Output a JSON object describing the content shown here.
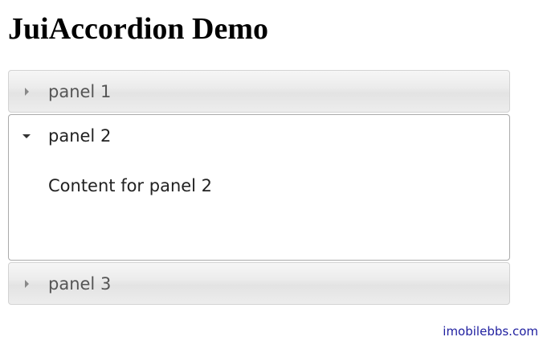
{
  "page": {
    "title": "JuiAccordion Demo"
  },
  "accordion": {
    "panels": [
      {
        "label": "panel 1",
        "expanded": false,
        "icon": "triangle-right-icon"
      },
      {
        "label": "panel 2",
        "expanded": true,
        "icon": "triangle-down-icon",
        "content": "Content for panel 2"
      },
      {
        "label": "panel 3",
        "expanded": false,
        "icon": "triangle-right-icon"
      }
    ]
  },
  "footer": {
    "credit": "imobilebbs.com"
  },
  "colors": {
    "header_border": "#d3d3d3",
    "active_border": "#aaaaaa",
    "label_inactive": "#555555",
    "label_active": "#222222",
    "credit": "#2020a0"
  }
}
